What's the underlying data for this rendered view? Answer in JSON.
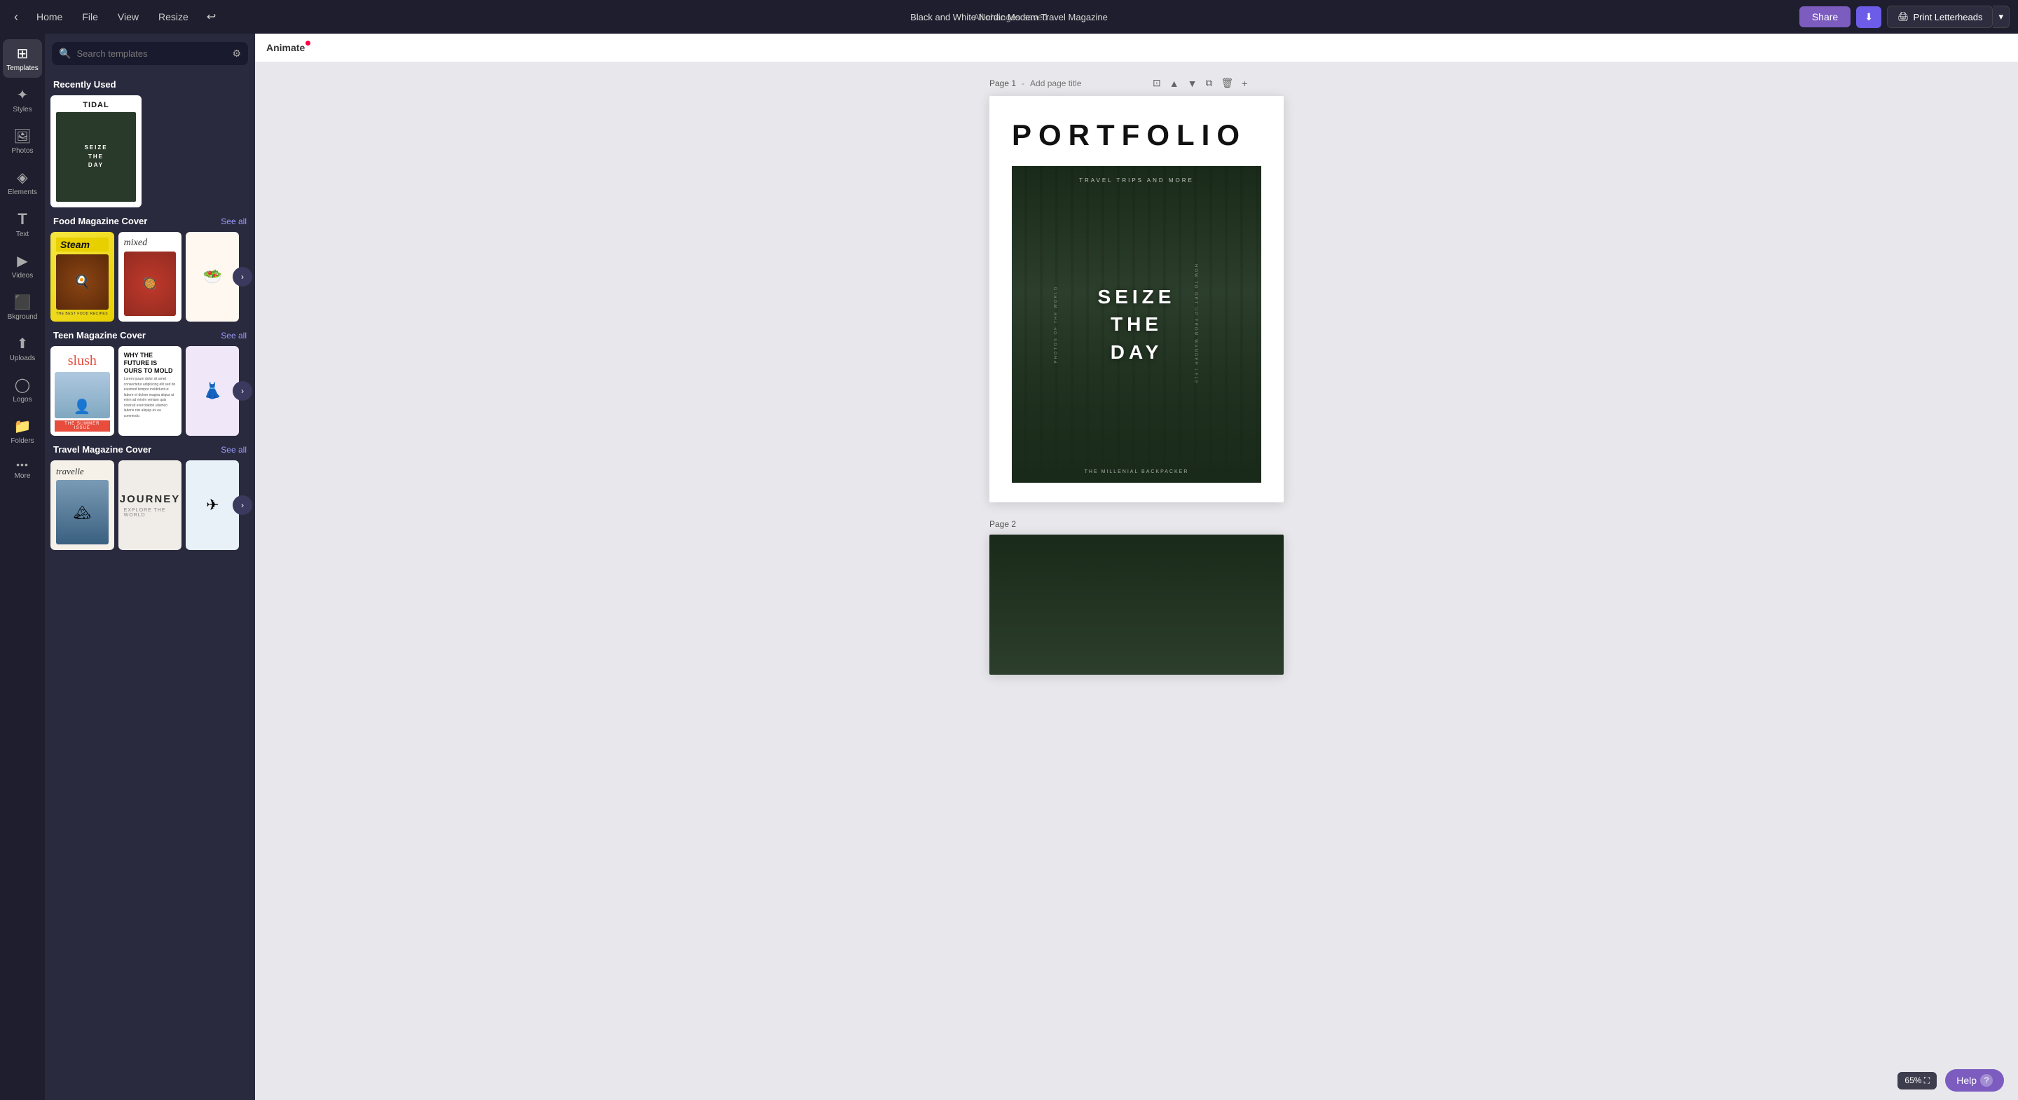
{
  "app": {
    "title": "Black and White Nordic Modern Travel Magazine",
    "saved_status": "All changes saved"
  },
  "topbar": {
    "home_label": "Home",
    "file_label": "File",
    "view_label": "View",
    "resize_label": "Resize",
    "share_label": "Share",
    "download_label": "⬇",
    "print_label": "Print Letterheads",
    "chevron_label": "▾"
  },
  "icon_sidebar": {
    "items": [
      {
        "id": "templates",
        "icon": "⊞",
        "label": "Templates",
        "active": true
      },
      {
        "id": "styles",
        "icon": "✦",
        "label": "Styles",
        "active": false
      },
      {
        "id": "photos",
        "icon": "🖼",
        "label": "Photos",
        "active": false
      },
      {
        "id": "elements",
        "icon": "◈",
        "label": "Elements",
        "active": false
      },
      {
        "id": "text",
        "icon": "T",
        "label": "Text",
        "active": false
      },
      {
        "id": "videos",
        "icon": "▶",
        "label": "Videos",
        "active": false
      },
      {
        "id": "background",
        "icon": "⬛",
        "label": "Bkground",
        "active": false
      },
      {
        "id": "uploads",
        "icon": "⬆",
        "label": "Uploads",
        "active": false
      },
      {
        "id": "logos",
        "icon": "◯",
        "label": "Logos",
        "active": false
      },
      {
        "id": "folders",
        "icon": "📁",
        "label": "Folders",
        "active": false
      },
      {
        "id": "more",
        "icon": "•••",
        "label": "More",
        "active": false
      }
    ]
  },
  "templates_panel": {
    "search_placeholder": "Search templates",
    "recently_used_label": "Recently Used",
    "recently_card": {
      "title": "TIDAL",
      "subtitle": "SEIZE THE DAY"
    },
    "sections": [
      {
        "id": "food",
        "title": "Food Magazine Cover",
        "see_all_label": "See all",
        "cards": [
          {
            "id": "steam",
            "label": "Steam",
            "type": "food1"
          },
          {
            "id": "mixed",
            "label": "mixed",
            "type": "food2"
          },
          {
            "id": "food3",
            "label": "",
            "type": "food3"
          }
        ]
      },
      {
        "id": "teen",
        "title": "Teen Magazine Cover",
        "see_all_label": "See all",
        "cards": [
          {
            "id": "slush",
            "label": "slush",
            "type": "teen1"
          },
          {
            "id": "future",
            "label": "WHY THE FUTURE IS OURS TO MOLD",
            "type": "teen2"
          },
          {
            "id": "teen3",
            "label": "",
            "type": "teen3"
          }
        ]
      },
      {
        "id": "travel",
        "title": "Travel Magazine Cover",
        "see_all_label": "See all",
        "cards": [
          {
            "id": "travelle",
            "label": "travelle",
            "type": "travel1"
          },
          {
            "id": "journey",
            "label": "JOURNEY",
            "type": "travel2"
          },
          {
            "id": "travel3",
            "label": "",
            "type": "travel3"
          }
        ]
      }
    ]
  },
  "canvas": {
    "animate_label": "Animate",
    "page1": {
      "label": "Page 1",
      "title_placeholder": "Add page title",
      "portfolio_title": "PORTFOLIO",
      "travel_label": "TRAVEL TRIPS AND MORE",
      "seize_text": "SEIZE\nTHE\nDAY",
      "side_left": "PHOTOS OF THE WORLD",
      "side_right": "HOW TO GET UP FROM WANDER LELE",
      "bottom_label": "THE MILLENIAL BACKPACKER"
    },
    "page2": {
      "label": "Page 2"
    }
  },
  "status_bar": {
    "zoom_label": "65%",
    "fullscreen_icon": "⛶",
    "help_label": "Help",
    "help_icon": "?"
  }
}
